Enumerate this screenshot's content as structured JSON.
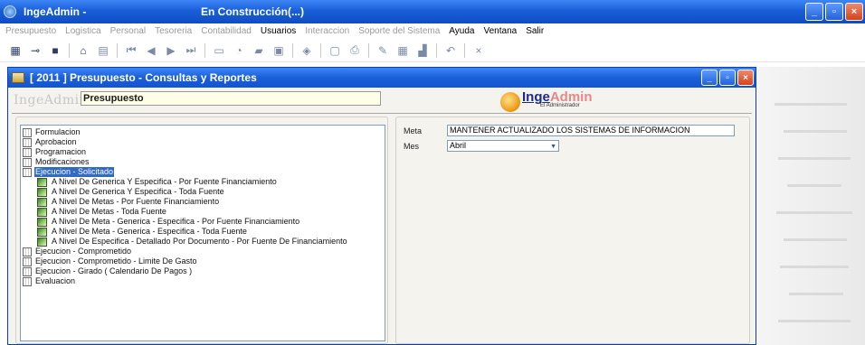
{
  "app": {
    "title": "IngeAdmin -",
    "status": "En Construcción(...)"
  },
  "window_buttons": [
    "_",
    "▫",
    "×"
  ],
  "menu": {
    "items": [
      {
        "label": "Presupuesto",
        "active": false
      },
      {
        "label": "Logistica",
        "active": false
      },
      {
        "label": "Personal",
        "active": false
      },
      {
        "label": "Tesoreria",
        "active": false
      },
      {
        "label": "Contabilidad",
        "active": false
      },
      {
        "label": "Usuarios",
        "active": true
      },
      {
        "label": "Interaccion",
        "active": false
      },
      {
        "label": "Soporte del Sistema",
        "active": false
      },
      {
        "label": "Ayuda",
        "active": true
      },
      {
        "label": "Ventana",
        "active": true
      },
      {
        "label": "Salir",
        "active": true
      }
    ]
  },
  "toolbar": {
    "close_glyph": "×"
  },
  "child_window": {
    "title": "[ 2011 ] Presupuesto - Consultas y Reportes",
    "brand_small": "IngeAdmin",
    "module": "Presupuesto",
    "brand_inge": "Inge",
    "brand_admin": "Admin",
    "brand_tag": "El Administrador"
  },
  "tree": {
    "items": [
      {
        "label": "Formulacion",
        "level": 0,
        "selected": false
      },
      {
        "label": "Aprobacion",
        "level": 0,
        "selected": false
      },
      {
        "label": "Programacion",
        "level": 0,
        "selected": false
      },
      {
        "label": "Modificaciones",
        "level": 0,
        "selected": false
      },
      {
        "label": "Ejecucion - Solicitado",
        "level": 0,
        "selected": true
      },
      {
        "label": "A Nivel De Generica Y Especifica - Por Fuente Financiamiento",
        "level": 1,
        "selected": false
      },
      {
        "label": "A Nivel De Generica Y Especifica - Toda Fuente",
        "level": 1,
        "selected": false
      },
      {
        "label": "A Nivel De Metas - Por Fuente Financiamiento",
        "level": 1,
        "selected": false
      },
      {
        "label": "A Nivel De Metas - Toda Fuente",
        "level": 1,
        "selected": false
      },
      {
        "label": "A Nivel De Meta - Generica - Especifica - Por Fuente Financiamiento",
        "level": 1,
        "selected": false
      },
      {
        "label": "A Nivel De Meta - Generica - Especifica - Toda Fuente",
        "level": 1,
        "selected": false
      },
      {
        "label": "A Nivel De Especifica - Detallado Por Documento - Por Fuente De Financiamiento",
        "level": 1,
        "selected": false
      },
      {
        "label": "Ejecucion - Comprometido",
        "level": 0,
        "selected": false
      },
      {
        "label": "Ejecucion - Comprometido - Limite De Gasto",
        "level": 0,
        "selected": false
      },
      {
        "label": "Ejecucion - Girado ( Calendario De Pagos )",
        "level": 0,
        "selected": false
      },
      {
        "label": "Evaluacion",
        "level": 0,
        "selected": false
      }
    ]
  },
  "form": {
    "meta_label": "Meta",
    "meta_value": "MANTENER ACTUALIZADO LOS SISTEMAS DE INFORMACION",
    "mes_label": "Mes",
    "mes_value": "Abril"
  }
}
